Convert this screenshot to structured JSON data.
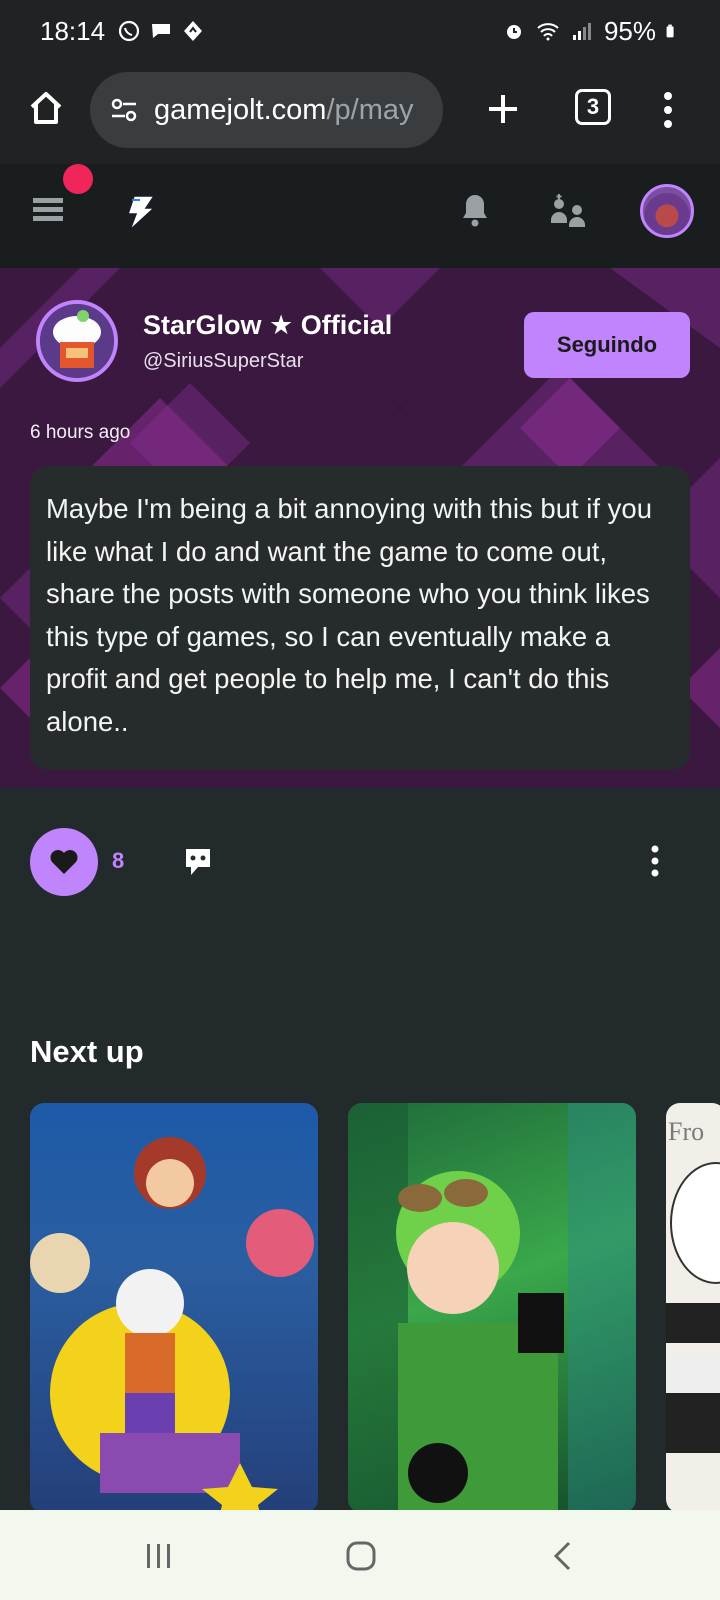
{
  "status_bar": {
    "time": "18:14",
    "battery": "95%",
    "left_icons": [
      "whatsapp-icon",
      "chat-icon",
      "navigation-icon"
    ],
    "right_icons": [
      "alarm-icon",
      "wifi-icon",
      "signal-icon",
      "battery-icon"
    ]
  },
  "browser": {
    "url_host": "gamejolt.com",
    "url_path": "/p/may",
    "tab_count": "3"
  },
  "site_header": {
    "icons": [
      "hamburger-icon",
      "gamejolt-logo-icon",
      "bell-icon",
      "friends-icon",
      "avatar"
    ]
  },
  "post": {
    "author_name": "StarGlow ★ Official",
    "author_handle": "@SiriusSuperStar",
    "follow_label": "Seguindo",
    "time_ago": "6 hours ago",
    "body": "Maybe I'm being a bit annoying with this but if you like what I do and want the game to come out, share the posts with someone who you think likes this type of games, so I can eventually make a profit and get people to help me, I can't do this alone..",
    "like_count": "8"
  },
  "next_up": {
    "title": "Next up",
    "card3_partial_text": "Fro"
  },
  "colors": {
    "accent": "#c084fc",
    "notif": "#f0255a",
    "page_bg": "#232a2b",
    "header_bg": "#191d1e"
  }
}
